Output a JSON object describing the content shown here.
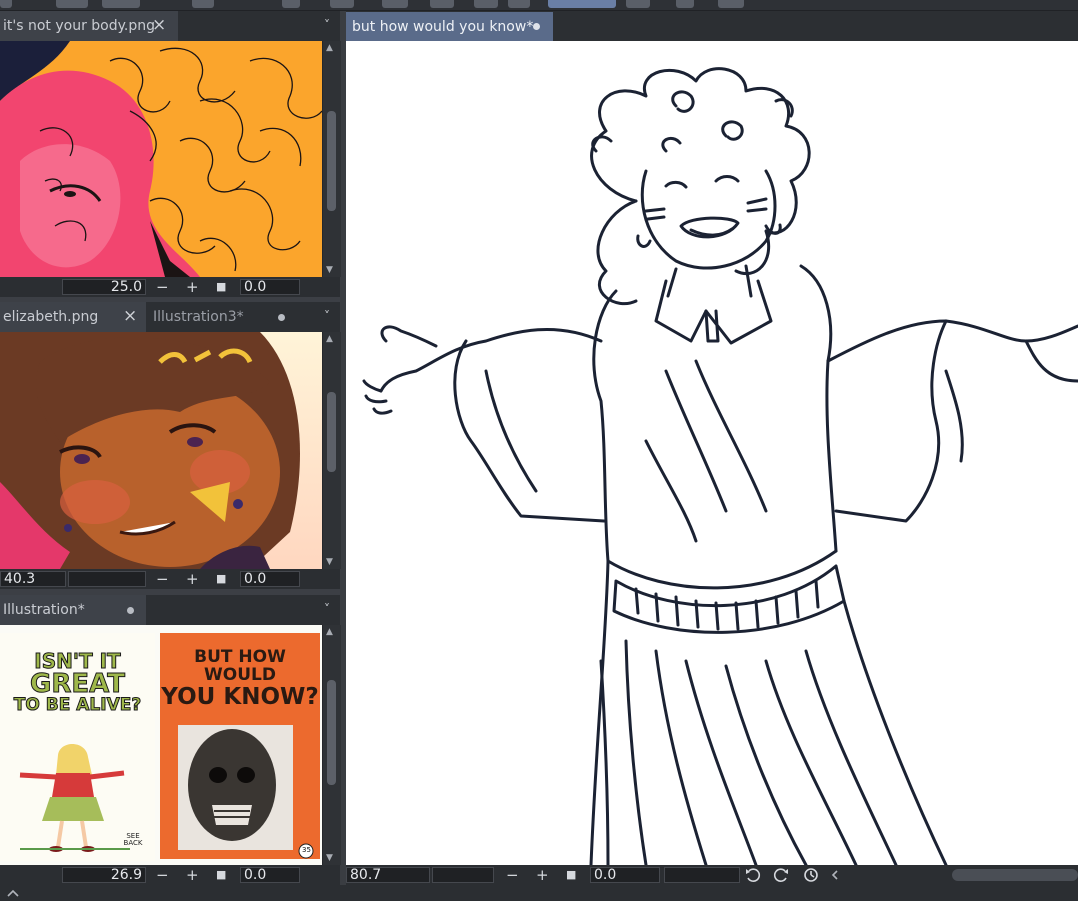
{
  "panels": [
    {
      "tabs": [
        {
          "label": "it's not your body.png",
          "active": true,
          "close": "×"
        }
      ],
      "zoom": "25.0",
      "rotation": "0.0",
      "thumbnail": "illustration-pink-orange-curly-hair"
    },
    {
      "tabs": [
        {
          "label": "elizabeth.png",
          "active": true,
          "close": "×"
        },
        {
          "label": "Illustration3*",
          "active": false
        }
      ],
      "zoom": "40.3",
      "rotation": "0.0",
      "thumbnail": "illustration-brown-curly-hair-girl"
    },
    {
      "tabs": [
        {
          "label": "Illustration*",
          "active": true
        }
      ],
      "zoom": "26.9",
      "rotation": "0.0",
      "thumbnail": "vintage-posters-reference",
      "poster_left": {
        "lines": [
          "ISN'T IT",
          "GREAT",
          "TO BE ALIVE?"
        ],
        "signature": "SEE BACK"
      },
      "poster_right": {
        "lines": [
          "BUT HOW WOULD",
          "YOU KNOW?"
        ],
        "badge": "35"
      }
    }
  ],
  "main": {
    "tab_label": "but how would you know*",
    "zoom": "80.7",
    "rotation": "0.0",
    "canvas": "line-sketch-curly-haired-girl-shrugging"
  },
  "controls": {
    "minus": "−",
    "plus": "+",
    "square": "■",
    "chevron": "˅"
  },
  "colors": {
    "pink": "#f2456f",
    "orange": "#fba52c",
    "tab_active": "#5a6b8a",
    "ink": "#1b2233"
  }
}
